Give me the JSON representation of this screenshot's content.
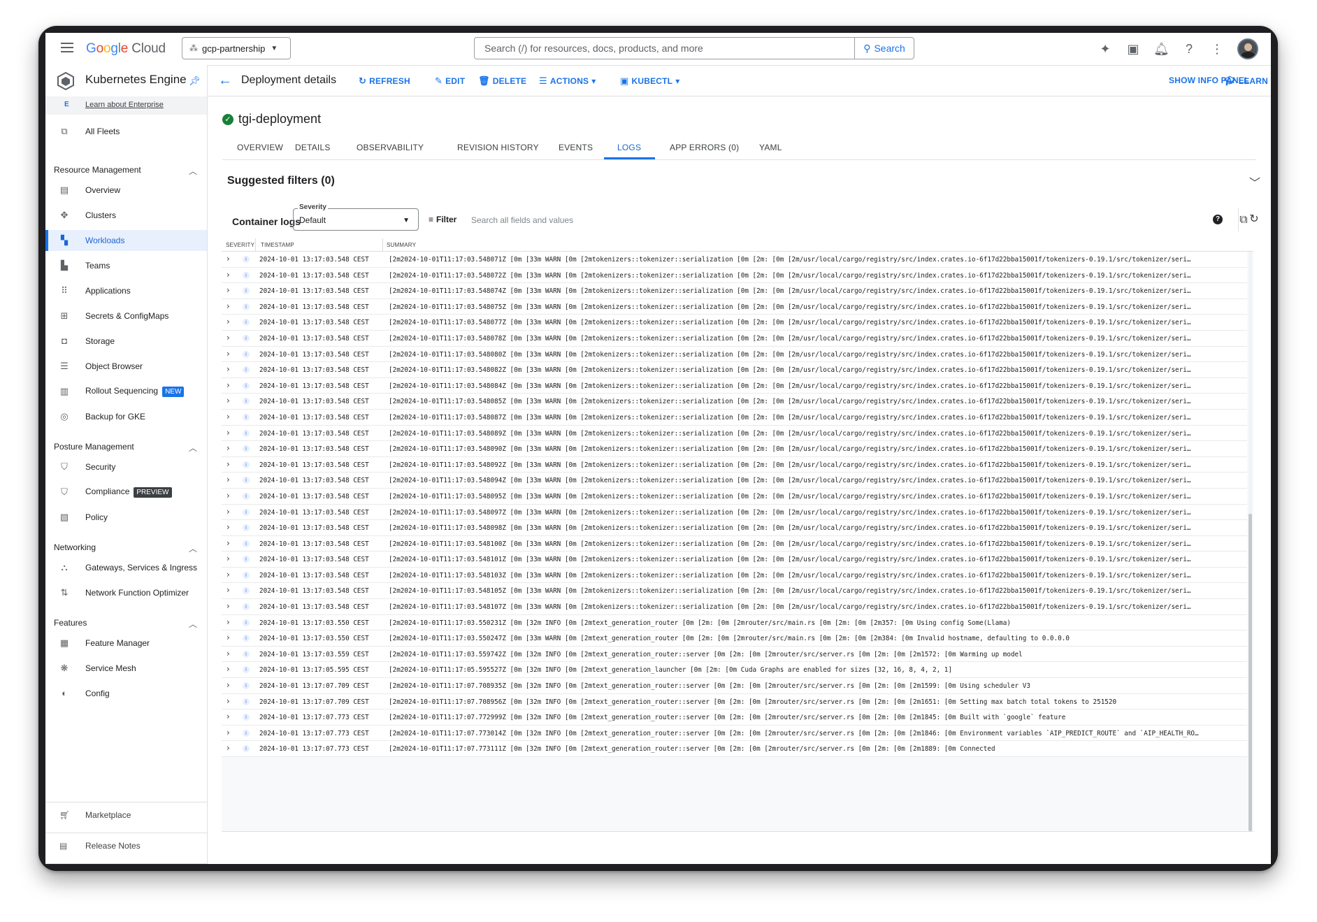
{
  "topbar": {
    "brand": [
      "G",
      "o",
      "o",
      "g",
      "l",
      "e"
    ],
    "brand_cloud": "Cloud",
    "project": "gcp-partnership",
    "search_placeholder": "Search (/) for resources, docs, products, and more",
    "search_button": "Search"
  },
  "sidebar": {
    "title": "Kubernetes Engine",
    "enterprise_badge": "E",
    "enterprise_link": "Learn about Enterprise",
    "all_fleets": "All Fleets",
    "sections": {
      "resource": "Resource Management",
      "posture": "Posture Management",
      "networking": "Networking",
      "features": "Features"
    },
    "items": {
      "overview": "Overview",
      "clusters": "Clusters",
      "workloads": "Workloads",
      "teams": "Teams",
      "applications": "Applications",
      "secrets": "Secrets & ConfigMaps",
      "storage": "Storage",
      "object_browser": "Object Browser",
      "rollout": "Rollout Sequencing",
      "backup": "Backup for GKE",
      "security": "Security",
      "compliance": "Compliance",
      "policy": "Policy",
      "gateways": "Gateways, Services & Ingress",
      "nfo": "Network Function Optimizer",
      "feature_manager": "Feature Manager",
      "service_mesh": "Service Mesh",
      "config": "Config"
    },
    "badges": {
      "new": "NEW",
      "preview": "PREVIEW"
    },
    "marketplace": "Marketplace",
    "release_notes": "Release Notes",
    "collapse": "<|"
  },
  "header": {
    "title": "Deployment details",
    "refresh": "REFRESH",
    "edit": "EDIT",
    "delete": "DELETE",
    "actions": "ACTIONS",
    "kubectl": "KUBECTL",
    "info_panel": "SHOW INFO PANEL",
    "learn": "LEARN"
  },
  "deployment": {
    "name": "tgi-deployment",
    "status_color": "#188038"
  },
  "tabs": [
    "OVERVIEW",
    "DETAILS",
    "OBSERVABILITY",
    "REVISION HISTORY",
    "EVENTS",
    "LOGS",
    "APP ERRORS (0)",
    "YAML"
  ],
  "active_tab": "LOGS",
  "suggested_filters": "Suggested filters (0)",
  "logs": {
    "container_label": "Container logs",
    "severity_label": "Severity",
    "severity_value": "Default",
    "filter_label": "Filter",
    "filter_placeholder": "Search all fields and values",
    "columns": [
      "SEVERITY",
      "TIMESTAMP",
      "SUMMARY"
    ],
    "rows": [
      {
        "ts": "2024-10-01 13:17:03.548 CEST",
        "summary": "[2m2024-10-01T11:17:03.548071Z [0m  [33m WARN [0m  [2mtokenizers::tokenizer::serialization [0m [2m: [0m  [2m/usr/local/cargo/registry/src/index.crates.io-6f17d22bba15001f/tokenizers-0.19.1/src/tokenizer/seri…"
      },
      {
        "ts": "2024-10-01 13:17:03.548 CEST",
        "summary": "[2m2024-10-01T11:17:03.548072Z [0m  [33m WARN [0m  [2mtokenizers::tokenizer::serialization [0m [2m: [0m  [2m/usr/local/cargo/registry/src/index.crates.io-6f17d22bba15001f/tokenizers-0.19.1/src/tokenizer/seri…"
      },
      {
        "ts": "2024-10-01 13:17:03.548 CEST",
        "summary": "[2m2024-10-01T11:17:03.548074Z [0m  [33m WARN [0m  [2mtokenizers::tokenizer::serialization [0m [2m: [0m  [2m/usr/local/cargo/registry/src/index.crates.io-6f17d22bba15001f/tokenizers-0.19.1/src/tokenizer/seri…"
      },
      {
        "ts": "2024-10-01 13:17:03.548 CEST",
        "summary": "[2m2024-10-01T11:17:03.548075Z [0m  [33m WARN [0m  [2mtokenizers::tokenizer::serialization [0m [2m: [0m  [2m/usr/local/cargo/registry/src/index.crates.io-6f17d22bba15001f/tokenizers-0.19.1/src/tokenizer/seri…"
      },
      {
        "ts": "2024-10-01 13:17:03.548 CEST",
        "summary": "[2m2024-10-01T11:17:03.548077Z [0m  [33m WARN [0m  [2mtokenizers::tokenizer::serialization [0m [2m: [0m  [2m/usr/local/cargo/registry/src/index.crates.io-6f17d22bba15001f/tokenizers-0.19.1/src/tokenizer/seri…"
      },
      {
        "ts": "2024-10-01 13:17:03.548 CEST",
        "summary": "[2m2024-10-01T11:17:03.548078Z [0m  [33m WARN [0m  [2mtokenizers::tokenizer::serialization [0m [2m: [0m  [2m/usr/local/cargo/registry/src/index.crates.io-6f17d22bba15001f/tokenizers-0.19.1/src/tokenizer/seri…"
      },
      {
        "ts": "2024-10-01 13:17:03.548 CEST",
        "summary": "[2m2024-10-01T11:17:03.548080Z [0m  [33m WARN [0m  [2mtokenizers::tokenizer::serialization [0m [2m: [0m  [2m/usr/local/cargo/registry/src/index.crates.io-6f17d22bba15001f/tokenizers-0.19.1/src/tokenizer/seri…"
      },
      {
        "ts": "2024-10-01 13:17:03.548 CEST",
        "summary": "[2m2024-10-01T11:17:03.548082Z [0m  [33m WARN [0m  [2mtokenizers::tokenizer::serialization [0m [2m: [0m  [2m/usr/local/cargo/registry/src/index.crates.io-6f17d22bba15001f/tokenizers-0.19.1/src/tokenizer/seri…"
      },
      {
        "ts": "2024-10-01 13:17:03.548 CEST",
        "summary": "[2m2024-10-01T11:17:03.548084Z [0m  [33m WARN [0m  [2mtokenizers::tokenizer::serialization [0m [2m: [0m  [2m/usr/local/cargo/registry/src/index.crates.io-6f17d22bba15001f/tokenizers-0.19.1/src/tokenizer/seri…"
      },
      {
        "ts": "2024-10-01 13:17:03.548 CEST",
        "summary": "[2m2024-10-01T11:17:03.548085Z [0m  [33m WARN [0m  [2mtokenizers::tokenizer::serialization [0m [2m: [0m  [2m/usr/local/cargo/registry/src/index.crates.io-6f17d22bba15001f/tokenizers-0.19.1/src/tokenizer/seri…"
      },
      {
        "ts": "2024-10-01 13:17:03.548 CEST",
        "summary": "[2m2024-10-01T11:17:03.548087Z [0m  [33m WARN [0m  [2mtokenizers::tokenizer::serialization [0m [2m: [0m  [2m/usr/local/cargo/registry/src/index.crates.io-6f17d22bba15001f/tokenizers-0.19.1/src/tokenizer/seri…"
      },
      {
        "ts": "2024-10-01 13:17:03.548 CEST",
        "summary": "[2m2024-10-01T11:17:03.548089Z [0m  [33m WARN [0m  [2mtokenizers::tokenizer::serialization [0m [2m: [0m  [2m/usr/local/cargo/registry/src/index.crates.io-6f17d22bba15001f/tokenizers-0.19.1/src/tokenizer/seri…"
      },
      {
        "ts": "2024-10-01 13:17:03.548 CEST",
        "summary": "[2m2024-10-01T11:17:03.548090Z [0m  [33m WARN [0m  [2mtokenizers::tokenizer::serialization [0m [2m: [0m  [2m/usr/local/cargo/registry/src/index.crates.io-6f17d22bba15001f/tokenizers-0.19.1/src/tokenizer/seri…"
      },
      {
        "ts": "2024-10-01 13:17:03.548 CEST",
        "summary": "[2m2024-10-01T11:17:03.548092Z [0m  [33m WARN [0m  [2mtokenizers::tokenizer::serialization [0m [2m: [0m  [2m/usr/local/cargo/registry/src/index.crates.io-6f17d22bba15001f/tokenizers-0.19.1/src/tokenizer/seri…"
      },
      {
        "ts": "2024-10-01 13:17:03.548 CEST",
        "summary": "[2m2024-10-01T11:17:03.548094Z [0m  [33m WARN [0m  [2mtokenizers::tokenizer::serialization [0m [2m: [0m  [2m/usr/local/cargo/registry/src/index.crates.io-6f17d22bba15001f/tokenizers-0.19.1/src/tokenizer/seri…"
      },
      {
        "ts": "2024-10-01 13:17:03.548 CEST",
        "summary": "[2m2024-10-01T11:17:03.548095Z [0m  [33m WARN [0m  [2mtokenizers::tokenizer::serialization [0m [2m: [0m  [2m/usr/local/cargo/registry/src/index.crates.io-6f17d22bba15001f/tokenizers-0.19.1/src/tokenizer/seri…"
      },
      {
        "ts": "2024-10-01 13:17:03.548 CEST",
        "summary": "[2m2024-10-01T11:17:03.548097Z [0m  [33m WARN [0m  [2mtokenizers::tokenizer::serialization [0m [2m: [0m  [2m/usr/local/cargo/registry/src/index.crates.io-6f17d22bba15001f/tokenizers-0.19.1/src/tokenizer/seri…"
      },
      {
        "ts": "2024-10-01 13:17:03.548 CEST",
        "summary": "[2m2024-10-01T11:17:03.548098Z [0m  [33m WARN [0m  [2mtokenizers::tokenizer::serialization [0m [2m: [0m  [2m/usr/local/cargo/registry/src/index.crates.io-6f17d22bba15001f/tokenizers-0.19.1/src/tokenizer/seri…"
      },
      {
        "ts": "2024-10-01 13:17:03.548 CEST",
        "summary": "[2m2024-10-01T11:17:03.548100Z [0m  [33m WARN [0m  [2mtokenizers::tokenizer::serialization [0m [2m: [0m  [2m/usr/local/cargo/registry/src/index.crates.io-6f17d22bba15001f/tokenizers-0.19.1/src/tokenizer/seri…"
      },
      {
        "ts": "2024-10-01 13:17:03.548 CEST",
        "summary": "[2m2024-10-01T11:17:03.548101Z [0m  [33m WARN [0m  [2mtokenizers::tokenizer::serialization [0m [2m: [0m  [2m/usr/local/cargo/registry/src/index.crates.io-6f17d22bba15001f/tokenizers-0.19.1/src/tokenizer/seri…"
      },
      {
        "ts": "2024-10-01 13:17:03.548 CEST",
        "summary": "[2m2024-10-01T11:17:03.548103Z [0m  [33m WARN [0m  [2mtokenizers::tokenizer::serialization [0m [2m: [0m  [2m/usr/local/cargo/registry/src/index.crates.io-6f17d22bba15001f/tokenizers-0.19.1/src/tokenizer/seri…"
      },
      {
        "ts": "2024-10-01 13:17:03.548 CEST",
        "summary": "[2m2024-10-01T11:17:03.548105Z [0m  [33m WARN [0m  [2mtokenizers::tokenizer::serialization [0m [2m: [0m  [2m/usr/local/cargo/registry/src/index.crates.io-6f17d22bba15001f/tokenizers-0.19.1/src/tokenizer/seri…"
      },
      {
        "ts": "2024-10-01 13:17:03.548 CEST",
        "summary": "[2m2024-10-01T11:17:03.548107Z [0m  [33m WARN [0m  [2mtokenizers::tokenizer::serialization [0m [2m: [0m  [2m/usr/local/cargo/registry/src/index.crates.io-6f17d22bba15001f/tokenizers-0.19.1/src/tokenizer/seri…"
      },
      {
        "ts": "2024-10-01 13:17:03.550 CEST",
        "summary": "[2m2024-10-01T11:17:03.550231Z [0m  [32m INFO [0m  [2mtext_generation_router [0m [2m: [0m  [2mrouter/src/main.rs [0m [2m: [0m [2m357: [0m Using config Some(Llama)"
      },
      {
        "ts": "2024-10-01 13:17:03.550 CEST",
        "summary": "[2m2024-10-01T11:17:03.550247Z [0m  [33m WARN [0m  [2mtext_generation_router [0m [2m: [0m  [2mrouter/src/main.rs [0m [2m: [0m [2m384: [0m Invalid hostname, defaulting to 0.0.0.0"
      },
      {
        "ts": "2024-10-01 13:17:03.559 CEST",
        "summary": "[2m2024-10-01T11:17:03.559742Z [0m  [32m INFO [0m  [2mtext_generation_router::server [0m [2m: [0m  [2mrouter/src/server.rs [0m [2m: [0m [2m1572: [0m Warming up model"
      },
      {
        "ts": "2024-10-01 13:17:05.595 CEST",
        "summary": "[2m2024-10-01T11:17:05.595527Z [0m  [32m INFO [0m  [2mtext_generation_launcher [0m [2m: [0m Cuda Graphs are enabled for sizes [32, 16, 8, 4, 2, 1]"
      },
      {
        "ts": "2024-10-01 13:17:07.709 CEST",
        "summary": "[2m2024-10-01T11:17:07.708935Z [0m  [32m INFO [0m  [2mtext_generation_router::server [0m [2m: [0m  [2mrouter/src/server.rs [0m [2m: [0m [2m1599: [0m Using scheduler V3"
      },
      {
        "ts": "2024-10-01 13:17:07.709 CEST",
        "summary": "[2m2024-10-01T11:17:07.708956Z [0m  [32m INFO [0m  [2mtext_generation_router::server [0m [2m: [0m  [2mrouter/src/server.rs [0m [2m: [0m [2m1651: [0m Setting max batch total tokens to 251520"
      },
      {
        "ts": "2024-10-01 13:17:07.773 CEST",
        "summary": "[2m2024-10-01T11:17:07.772999Z [0m  [32m INFO [0m  [2mtext_generation_router::server [0m [2m: [0m  [2mrouter/src/server.rs [0m [2m: [0m [2m1845: [0m Built with `google` feature"
      },
      {
        "ts": "2024-10-01 13:17:07.773 CEST",
        "summary": "[2m2024-10-01T11:17:07.773014Z [0m  [32m INFO [0m  [2mtext_generation_router::server [0m [2m: [0m  [2mrouter/src/server.rs [0m [2m: [0m [2m1846: [0m Environment variables `AIP_PREDICT_ROUTE` and `AIP_HEALTH_RO…"
      },
      {
        "ts": "2024-10-01 13:17:07.773 CEST",
        "summary": "[2m2024-10-01T11:17:07.773111Z [0m  [32m INFO [0m  [2mtext_generation_router::server [0m [2m: [0m  [2mrouter/src/server.rs [0m [2m: [0m [2m1889: [0m Connected"
      }
    ]
  },
  "colors": {
    "accent": "#1a73e8",
    "active_bg": "#e8f0fe",
    "success": "#188038"
  }
}
